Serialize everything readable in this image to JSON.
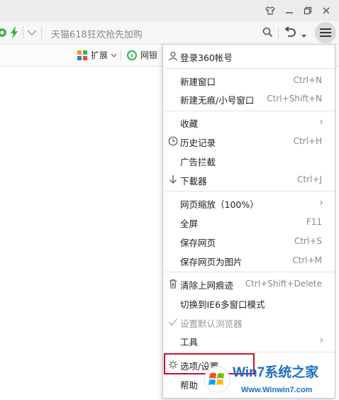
{
  "address_bar": {
    "url_text": "天猫618狂欢抢先加购"
  },
  "ext_bar": {
    "extension_label": "扩展",
    "bank_label": "网银"
  },
  "menu": {
    "items": [
      {
        "label": "登录360帐号",
        "shortcut": "",
        "icon": "user-icon"
      },
      {
        "label": "新建窗口",
        "shortcut": "Ctrl+N"
      },
      {
        "label": "新建无痕/小号窗口",
        "shortcut": "Ctrl+Shift+N"
      },
      {
        "label": "收藏",
        "shortcut": "",
        "submenu": true
      },
      {
        "label": "历史记录",
        "shortcut": "Ctrl+H",
        "icon": "clock-icon"
      },
      {
        "label": "广告拦截",
        "shortcut": ""
      },
      {
        "label": "下載器",
        "shortcut": "Ctrl+J",
        "icon": "download-arrow-icon"
      },
      {
        "label": "网页缩放（100%）",
        "shortcut": "",
        "submenu": true
      },
      {
        "label": "全屏",
        "shortcut": "F11"
      },
      {
        "label": "保存网页",
        "shortcut": "Ctrl+S"
      },
      {
        "label": "保存网页为图片",
        "shortcut": "Ctrl+M"
      },
      {
        "label": "清除上网痕迹",
        "shortcut": "Ctrl+Shift+Delete",
        "icon": "trash-icon"
      },
      {
        "label": "切换到IE6多窗口模式",
        "shortcut": ""
      },
      {
        "label": "设置默认浏览器",
        "shortcut": "",
        "icon": "check-icon",
        "disabled": true
      },
      {
        "label": "工具",
        "shortcut": "",
        "submenu": true
      },
      {
        "label": "选项/设置",
        "shortcut": "",
        "icon": "gear-icon",
        "highlighted": true
      },
      {
        "label": "帮助",
        "shortcut": ""
      }
    ]
  },
  "watermark": {
    "brand_text": "Win7系统之家",
    "url_text": "Www.Winwin7.com"
  }
}
